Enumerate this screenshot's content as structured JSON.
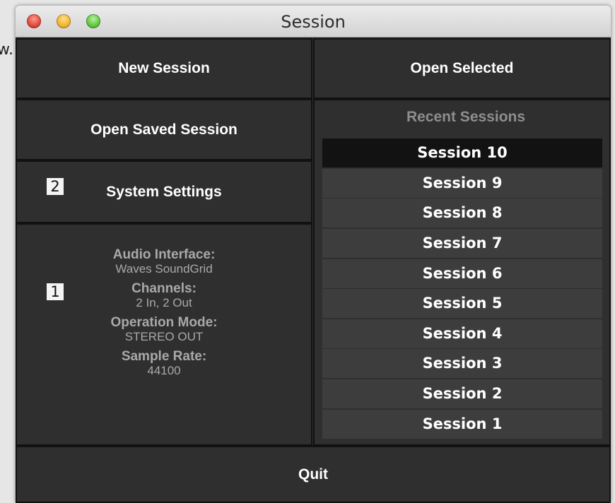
{
  "background": {
    "partial_text": "w."
  },
  "window": {
    "title": "Session"
  },
  "buttons": {
    "new_session": "New Session",
    "open_selected": "Open Selected",
    "open_saved_session": "Open Saved Session",
    "system_settings": "System Settings",
    "quit": "Quit"
  },
  "badges": {
    "one": "1",
    "two": "2"
  },
  "info": [
    {
      "label": "Audio Interface:",
      "value": "Waves SoundGrid"
    },
    {
      "label": "Channels:",
      "value": "2 In, 2 Out"
    },
    {
      "label": "Operation Mode:",
      "value": "STEREO OUT"
    },
    {
      "label": "Sample Rate:",
      "value": "44100"
    }
  ],
  "recent": {
    "header": "Recent Sessions",
    "selected_index": 0,
    "items": [
      "Session 10",
      "Session 9",
      "Session 8",
      "Session 7",
      "Session 6",
      "Session 5",
      "Session 4",
      "Session 3",
      "Session 2",
      "Session 1"
    ]
  },
  "colors": {
    "window_bg": "#2e2e2e",
    "row_bg": "#3d3d3d",
    "selected_row_bg": "#121212",
    "info_text": "#a9a9a9"
  }
}
